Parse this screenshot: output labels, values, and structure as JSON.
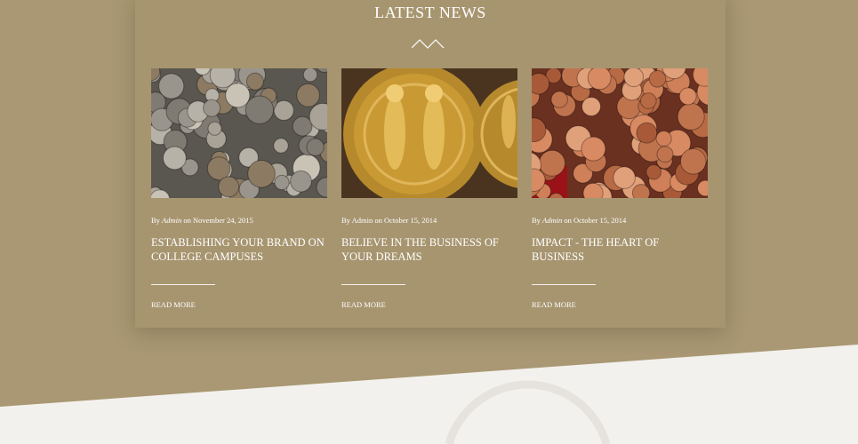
{
  "section": {
    "title": "LATEST NEWS",
    "divider_icon": "double-chevron-up-icon"
  },
  "posts": [
    {
      "by": "By",
      "author": "Admin",
      "on": "on",
      "date": "November 24, 2015",
      "title": "ESTABLISHING YOUR BRAND ON COLLEGE CAMPUSES",
      "read_more": "READ MORE",
      "image": "pile-of-silver-coins"
    },
    {
      "by": "By",
      "author": "Admin",
      "on": "on",
      "date": "October 15, 2014",
      "title": "BELIEVE IN THE BUSINESS OF YOUR DREAMS",
      "read_more": "READ MORE",
      "image": "ancient-gold-coins"
    },
    {
      "by": "By",
      "author": "Admin",
      "on": "on",
      "date": "October 15, 2014",
      "title": "IMPACT - THE HEART OF BUSINESS",
      "read_more": "READ MORE",
      "image": "copper-penny-pile"
    }
  ],
  "colors": {
    "background": "#a99873",
    "panel": "#a79570",
    "light_section": "#f3f1ed",
    "text": "#ffffff"
  }
}
